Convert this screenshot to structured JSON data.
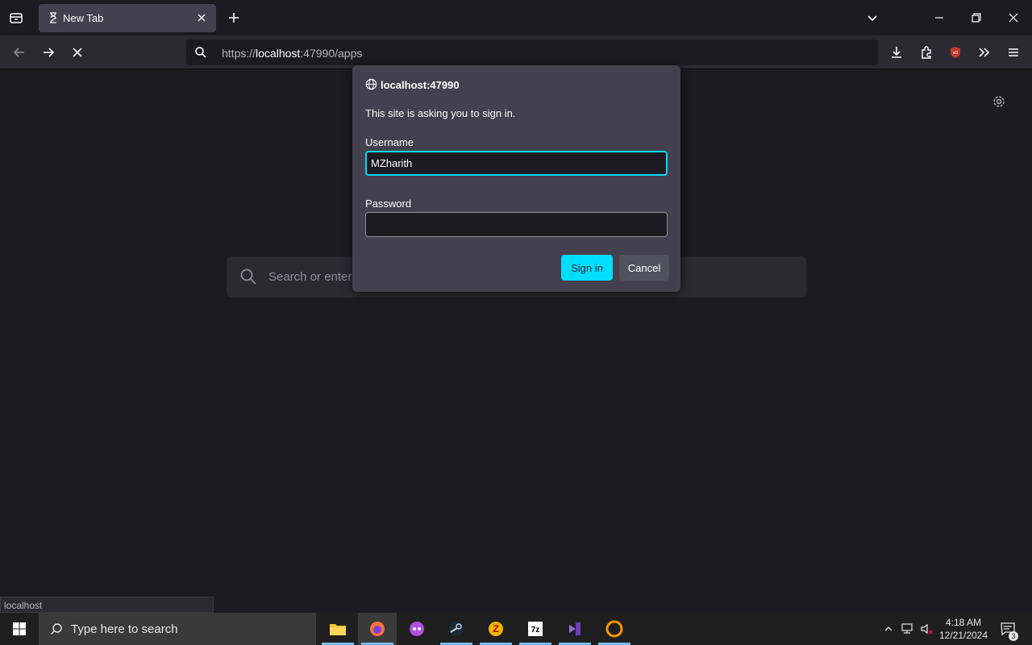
{
  "browser": {
    "tab": {
      "title": "New Tab"
    },
    "url": {
      "prefix": "https://",
      "host": "localhost",
      "suffix": ":47990/apps"
    },
    "new_tab_page": {
      "search_placeholder": "Search or enter"
    },
    "status_text": "localhost"
  },
  "auth_dialog": {
    "host": "localhost:47990",
    "message": "This site is asking you to sign in.",
    "username_label": "Username",
    "username_value": "MZharith",
    "password_label": "Password",
    "password_value": "",
    "sign_in_label": "Sign in",
    "cancel_label": "Cancel"
  },
  "taskbar": {
    "search_placeholder": "Type here to search",
    "time": "4:18 AM",
    "date": "12/21/2024",
    "notifications_count": "3"
  },
  "colors": {
    "accent": "#00ddff",
    "background": "#1c1b22",
    "dialog": "#42414d"
  }
}
